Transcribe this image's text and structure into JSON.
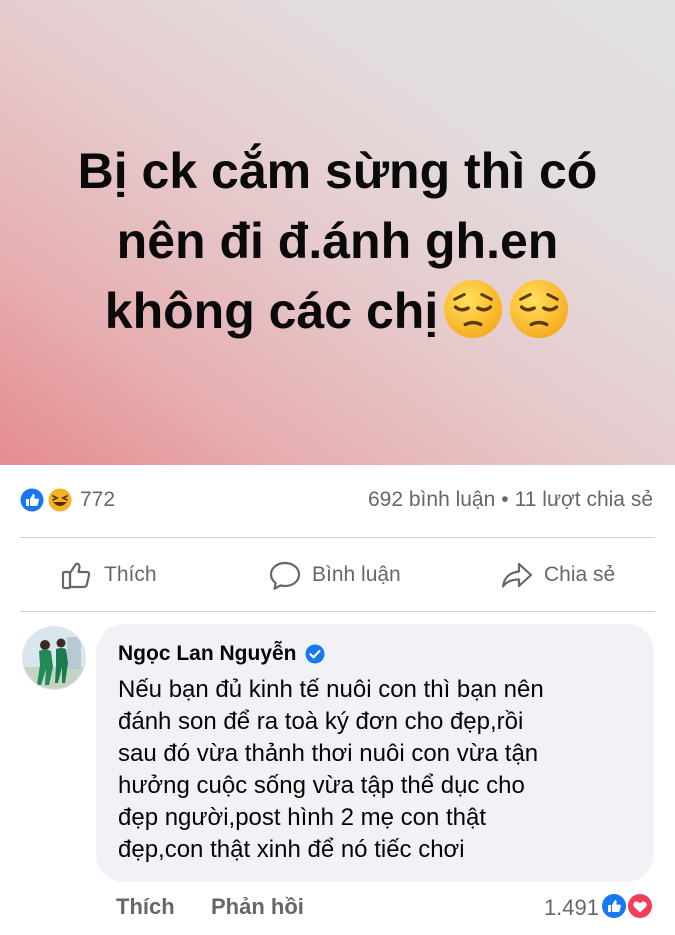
{
  "post": {
    "banner_lines": [
      "Bị ck cắm sừng thì có",
      "nên đi đ.ánh gh.en",
      "không các chị"
    ],
    "banner_emojis": [
      "pensive-face-icon",
      "pensive-face-icon"
    ],
    "background_colors": [
      "#e58c8f",
      "#e2e0e1"
    ]
  },
  "reactions": {
    "icons": [
      "like-reaction-icon",
      "haha-reaction-icon"
    ],
    "count": "772",
    "comments": "692 bình luận",
    "separator": "•",
    "shares": "11 lượt chia sẻ"
  },
  "actions": {
    "like": "Thích",
    "comment": "Bình luận",
    "share": "Chia sẻ"
  },
  "comment": {
    "author": "Ngọc Lan Nguyễn",
    "verified_icon": "verified-badge-icon",
    "text_lines": [
      "Nếu bạn đủ kinh tế nuôi con thì bạn nên",
      "đánh son để ra toà ký đơn cho đẹp,rồi",
      "sau đó vừa thảnh thơi nuôi con vừa tận",
      "hưởng cuộc sống vừa tập thể dục cho",
      "đẹp người,post hình 2 mẹ con thật",
      "đẹp,con thật xinh để nó tiếc chơi"
    ],
    "like_label": "Thích",
    "reply_label": "Phản hồi",
    "reaction_count": "1.491",
    "reaction_icons": [
      "like-reaction-icon",
      "love-reaction-icon"
    ]
  },
  "colors": {
    "accent_blue": "#1877f2",
    "love_red": "#f33e58",
    "haha_yellow": "#f7b125",
    "muted_text": "#65676b"
  }
}
